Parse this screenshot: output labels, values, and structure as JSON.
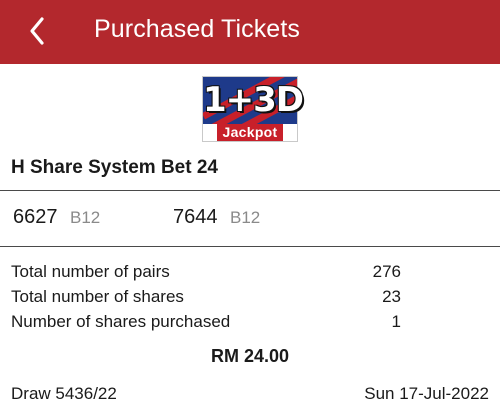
{
  "appbar": {
    "title": "Purchased Tickets",
    "back_icon": "chevron-left-icon",
    "color": "#b3282d"
  },
  "logo": {
    "main_text": "1+3D",
    "sub_text": "Jackpot"
  },
  "bet": {
    "title": "H Share System Bet 24"
  },
  "numbers": [
    {
      "number": "6627",
      "code": "B12"
    },
    {
      "number": "7644",
      "code": "B12"
    }
  ],
  "stats": [
    {
      "label": "Total number of pairs",
      "value": "276"
    },
    {
      "label": "Total number of shares",
      "value": "23"
    },
    {
      "label": "Number of shares purchased",
      "value": "1"
    }
  ],
  "total_amount": "RM 24.00",
  "draw": "Draw 5436/22",
  "date": "Sun 17-Jul-2022"
}
